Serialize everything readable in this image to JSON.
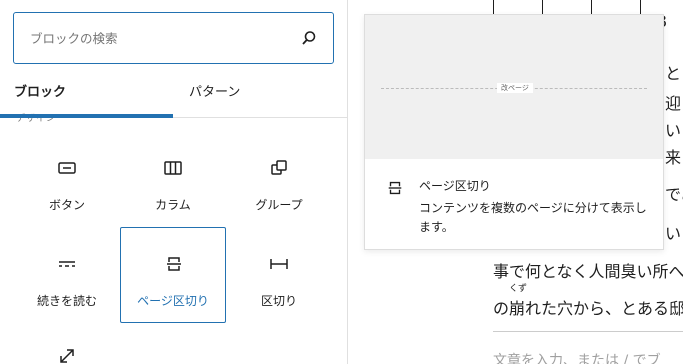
{
  "search": {
    "placeholder": "ブロックの検索"
  },
  "tabs": [
    {
      "label": "ブロック"
    },
    {
      "label": "パターン"
    }
  ],
  "category": {
    "label": "デザイン"
  },
  "blocks": [
    {
      "label": "ボタン",
      "icon": "button-icon"
    },
    {
      "label": "カラム",
      "icon": "columns-icon"
    },
    {
      "label": "グループ",
      "icon": "group-icon"
    },
    {
      "label": "続きを読む",
      "icon": "more-icon"
    },
    {
      "label": "ページ区切り",
      "icon": "page-break-icon"
    },
    {
      "label": "区切り",
      "icon": "separator-icon"
    }
  ],
  "preview": {
    "page_break_label": "改ページ",
    "title": "ページ区切り",
    "description": "コンテンツを複数のページに分けて表示します。"
  },
  "editor": {
    "lines": [
      "と",
      "迎",
      "い",
      "来",
      "であ",
      "い"
    ],
    "line_a": "事で何となく人間臭い所へ",
    "ruby": "くず",
    "line_b": "の崩れた穴から、とある邸",
    "placeholder": "文章を入力、または / でブ",
    "grid_char": "3"
  },
  "colors": {
    "accent": "#2271b1"
  }
}
